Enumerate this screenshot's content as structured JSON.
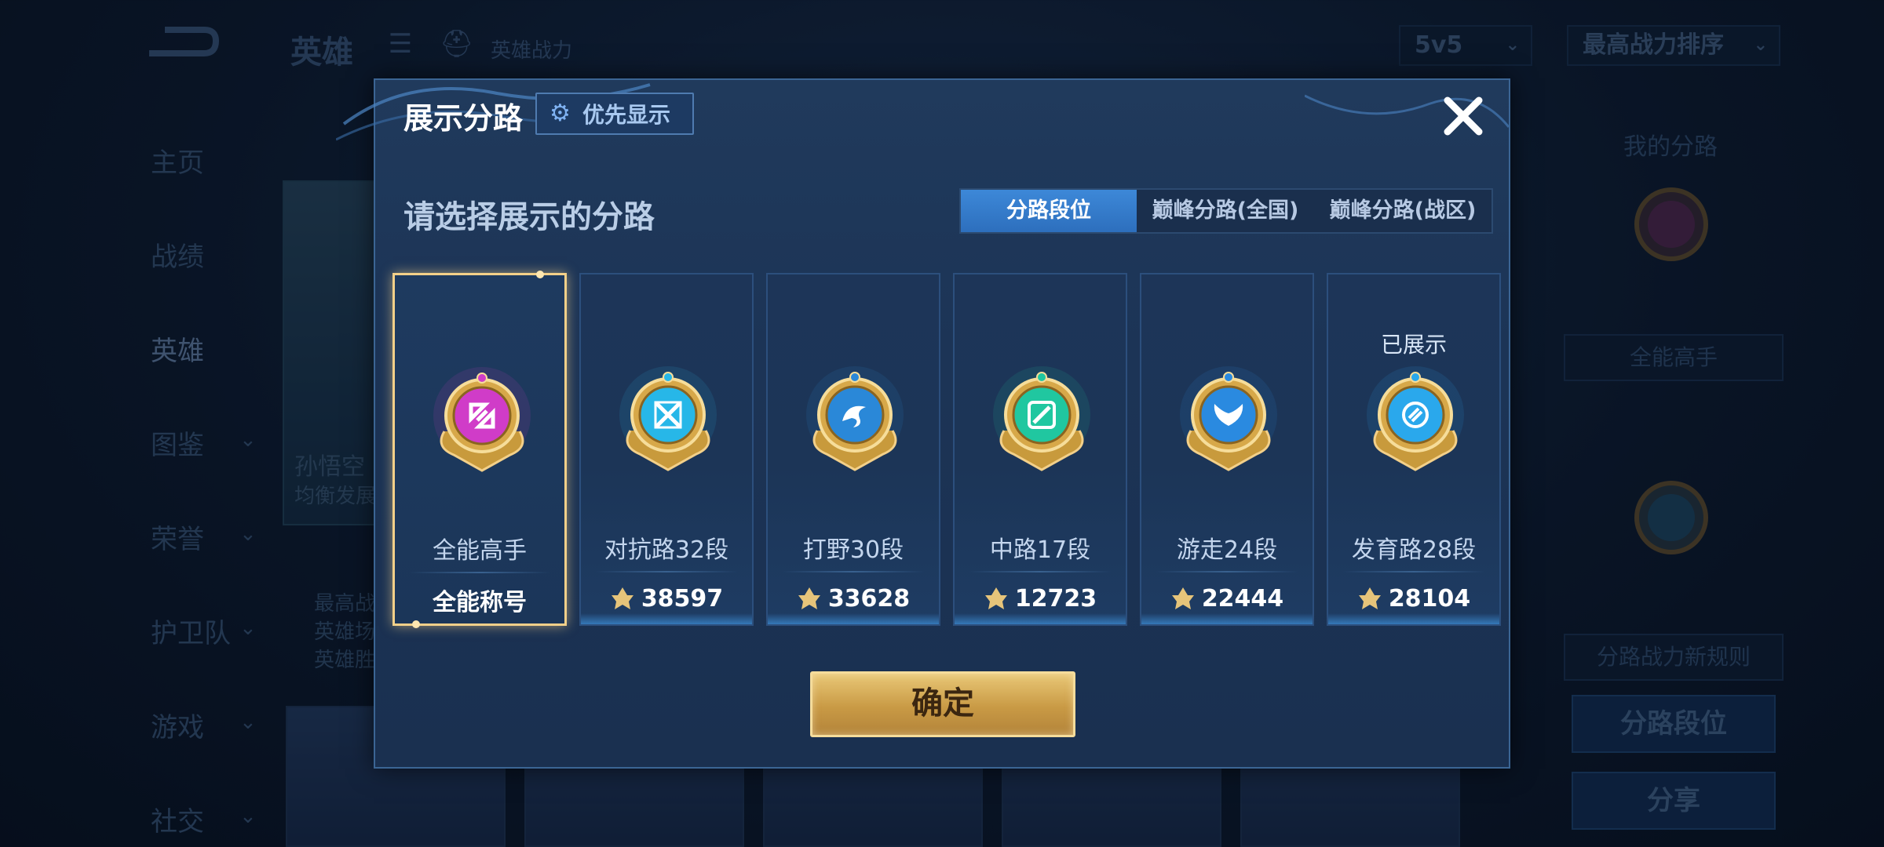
{
  "background": {
    "header": {
      "title": "英雄",
      "subtitle": "英雄战力",
      "mode_select": "5v5",
      "sort_select": "最高战力排序"
    },
    "side_nav": [
      {
        "label": "主页",
        "has_chevron": false
      },
      {
        "label": "战绩",
        "has_chevron": false
      },
      {
        "label": "英雄",
        "has_chevron": false,
        "active": true
      },
      {
        "label": "图鉴",
        "has_chevron": true
      },
      {
        "label": "荣誉",
        "has_chevron": true
      },
      {
        "label": "护卫队",
        "has_chevron": true
      },
      {
        "label": "游戏",
        "has_chevron": true
      },
      {
        "label": "社交",
        "has_chevron": true
      }
    ],
    "hero": {
      "name": "孙悟空",
      "sub": "均衡发展",
      "stats": [
        "最高战",
        "英雄场",
        "英雄胜"
      ]
    },
    "right_panel": {
      "my_lane_label": "我的分路",
      "lane_title_box": "全能高手",
      "rule_box": "分路战力新规则",
      "lane_rank_button": "分路段位",
      "share_button": "分享"
    }
  },
  "modal": {
    "title": "展示分路",
    "pref_button": "优先显示",
    "section_title": "请选择展示的分路",
    "tabs": [
      "分路段位",
      "巅峰分路(全国)",
      "巅峰分路(战区)"
    ],
    "active_tab": 0,
    "cards": [
      {
        "lane": "全能高手",
        "footer": "全能称号",
        "power": null,
        "selected": true,
        "shown": false,
        "badge_color": "#d03cc8",
        "emblem": "omni"
      },
      {
        "lane": "对抗路32段",
        "power": "38597",
        "selected": false,
        "shown": false,
        "badge_color": "#27b7e8",
        "emblem": "swords"
      },
      {
        "lane": "打野30段",
        "power": "33628",
        "selected": false,
        "shown": false,
        "badge_color": "#2a88d8",
        "emblem": "beast"
      },
      {
        "lane": "中路17段",
        "power": "12723",
        "selected": false,
        "shown": false,
        "badge_color": "#20c7a0",
        "emblem": "mid"
      },
      {
        "lane": "游走24段",
        "power": "22444",
        "selected": false,
        "shown": false,
        "badge_color": "#2a8ae0",
        "emblem": "wings"
      },
      {
        "lane": "发育路28段",
        "power": "28104",
        "selected": false,
        "shown": true,
        "shown_label": "已展示",
        "badge_color": "#2aa8ec",
        "emblem": "adc"
      }
    ],
    "confirm_button": "确定",
    "colors": {
      "accent_gold": "#f3d089",
      "tab_active": "#3d88d8",
      "modal_bg": "#1c3456"
    }
  }
}
